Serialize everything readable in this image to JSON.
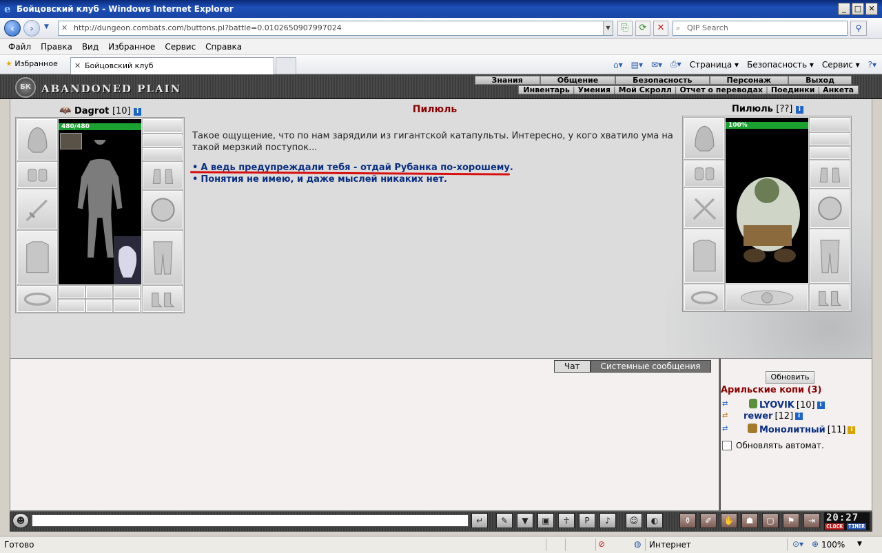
{
  "window": {
    "title": "Бойцовский клуб - Windows Internet Explorer",
    "minimize": "_",
    "maximize": "□",
    "close": "✕"
  },
  "address": {
    "url": "http://dungeon.combats.com/buttons.pl?battle=0.0102650907997024",
    "search_placeholder": "QIP Search"
  },
  "menu": [
    "Файл",
    "Правка",
    "Вид",
    "Избранное",
    "Сервис",
    "Справка"
  ],
  "tabs": {
    "favorites": "Избранное",
    "active_tab": "Бойцовский клуб"
  },
  "commandbar": [
    "Страница",
    "Безопасность",
    "Сервис"
  ],
  "game": {
    "location": "ABANDONED PLAIN",
    "logo_text": "БК",
    "top_menu": [
      "Знания",
      "Общение",
      "Безопасность",
      "Персонаж",
      "Выход"
    ],
    "sub_menu": [
      "Инвентарь",
      "Умения",
      "Мой Скролл",
      "Отчет о переводах",
      "Поединки",
      "Анкета"
    ]
  },
  "player": {
    "name": "Dagrot",
    "level": "[10]",
    "hp": "480/480",
    "hp_fraction": 1.0
  },
  "npc": {
    "name": "Пилюль",
    "level": "[??]",
    "hp": "100%",
    "hp_fraction": 1.0
  },
  "dialog": {
    "title": "Пилюль",
    "text": "Такое ощущение, что по нам зарядили из гигантской катапульты. Интересно, у кого хватило ума на такой мерзкий поступок...",
    "answers": [
      "А ведь предупреждали тебя - отдай Рубанка по-хорошему.",
      "Понятия не имею, и даже мыслей никаких нет."
    ]
  },
  "chat": {
    "tabs": [
      "Чат",
      "Системные сообщения"
    ]
  },
  "online": {
    "refresh_label": "Обновить",
    "room": "Арильские копи (3)",
    "users": [
      {
        "name": "LYOVIK",
        "level": "[10]"
      },
      {
        "name": "rewer",
        "level": "[12]"
      },
      {
        "name": "Монолитный",
        "level": "[11]"
      }
    ],
    "auto_refresh_label": "Обновлять автомат."
  },
  "clock": {
    "time": "20:27",
    "clock_label": "CLOCK",
    "timer_label": "TIMER"
  },
  "status": {
    "ready": "Готово",
    "zone": "Интернет",
    "zoom": "100%"
  },
  "colors": {
    "npc_title": "#8b0000",
    "answer_link": "#0a2f80",
    "hp_bar": "#1aa12f",
    "underline": "#d81010"
  }
}
